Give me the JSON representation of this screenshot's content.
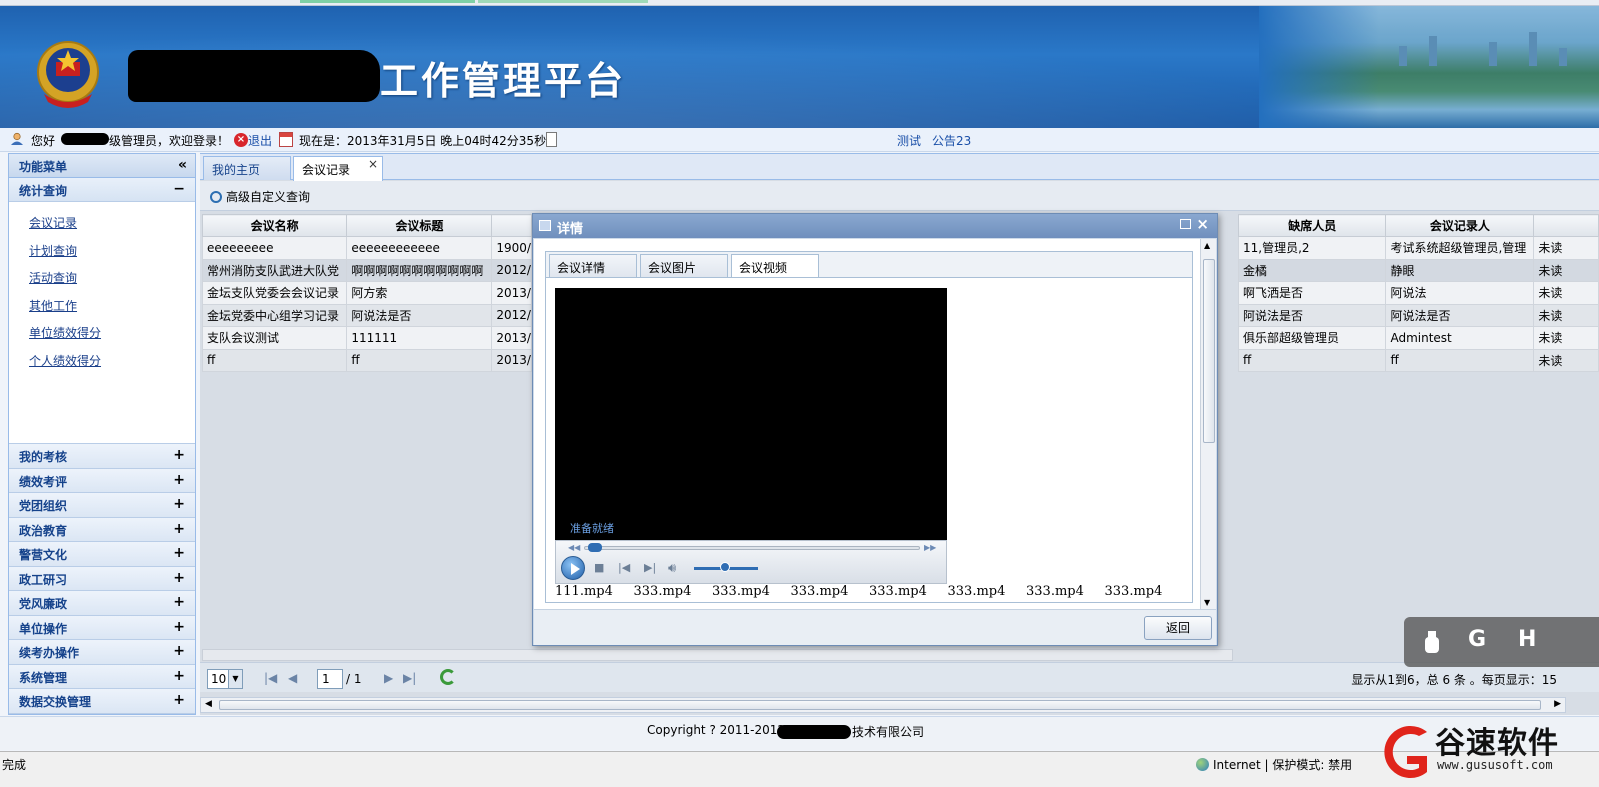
{
  "header": {
    "title": "工作管理平台"
  },
  "welcome": {
    "hello": "您好",
    "role": "级管理员，欢迎登录！",
    "logout": "退出",
    "now_label": "现在是：2013年31月5日 晚上04时42分35秒",
    "link1": "测试",
    "link2": "公告23"
  },
  "sidebar": {
    "title": "功能菜单",
    "collapse": "«",
    "section": "统计查询",
    "section_toggle": "−",
    "links": [
      "会议记录",
      "计划查询",
      "活动查询",
      "其他工作",
      "单位绩效得分",
      "个人绩效得分"
    ],
    "groups": [
      "我的考核",
      "绩效考评",
      "党团组织",
      "政治教育",
      "警营文化",
      "政工研习",
      "党风廉政",
      "单位操作",
      "续考办操作",
      "系统管理",
      "数据交换管理"
    ],
    "group_toggle": "+"
  },
  "tabs": [
    {
      "label": "我的主页"
    },
    {
      "label": "会议记录",
      "close": "×"
    }
  ],
  "toolbar": {
    "advanced_query": "高级自定义查询"
  },
  "grid": {
    "headers_left": [
      "会议名称",
      "会议标题"
    ],
    "headers_right": [
      "缺席人员",
      "会议记录人"
    ],
    "rows": [
      {
        "name": "eeeeeeeee",
        "title": "eeeeeeeeeeee",
        "date": "1900/",
        "absent": "11,管理员,2",
        "recorder": "考试系统超级管理员,管理",
        "status": "未读"
      },
      {
        "name": "常州消防支队武进大队党",
        "title": "啊啊啊啊啊啊啊啊啊啊啊",
        "date": "2012/",
        "absent": "金橘",
        "recorder": "静眼",
        "status": "未读"
      },
      {
        "name": "金坛支队党委会会议记录",
        "title": "阿方索",
        "date": "2013/",
        "absent": "啊飞洒是否",
        "recorder": "阿说法",
        "status": "未读"
      },
      {
        "name": "金坛党委中心组学习记录",
        "title": "阿说法是否",
        "date": "2012/",
        "absent": "阿说法是否",
        "recorder": "阿说法是否",
        "status": "未读"
      },
      {
        "name": "支队会议测试",
        "title": "111111",
        "date": "2013/",
        "absent": "俱乐部超级管理员",
        "recorder": "Admintest",
        "status": "未读"
      },
      {
        "name": "ff",
        "title": "ff",
        "date": "2013/",
        "absent": "ff",
        "recorder": "ff",
        "status": "未读"
      }
    ]
  },
  "pager": {
    "page_size": "10",
    "page": "1",
    "of_pages": "/ 1",
    "info": "显示从1到6，总 6 条 。每页显示：15"
  },
  "footer": {
    "copyright_prefix": "Copyright ? 2011-2012",
    "copyright_suffix": "技术有限公司"
  },
  "statusbar": {
    "done": "完成",
    "zone": "Internet | 保护模式: 禁用"
  },
  "watermark": {
    "brand": "谷速软件",
    "url": "www.gususoft.com"
  },
  "sidewidget": {
    "letters": [
      "G",
      "H"
    ]
  },
  "modal": {
    "title": "详情",
    "tabs": [
      "会议详情",
      "会议图片",
      "会议视频"
    ],
    "active_tab": 2,
    "video_status": "准备就绪",
    "files": [
      "111.mp4",
      "333.mp4",
      "333.mp4",
      "333.mp4",
      "333.mp4",
      "333.mp4",
      "333.mp4",
      "333.mp4",
      "3"
    ],
    "back_button": "返回"
  }
}
